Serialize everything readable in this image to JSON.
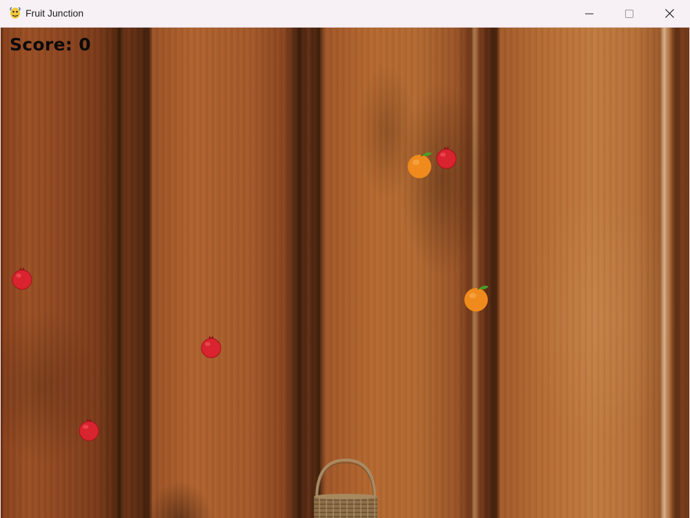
{
  "window": {
    "title": "Fruit Junction",
    "app_icon": "python-icon",
    "controls": [
      "minimize-icon",
      "maximize-icon",
      "close-icon"
    ]
  },
  "game": {
    "score_label": "Score: 0",
    "background": "wood-planks",
    "fruits": [
      {
        "type": "pomegranate",
        "color": "#d9232e"
      },
      {
        "type": "orange",
        "color": "#f08a1c"
      },
      {
        "type": "pomegranate",
        "color": "#d9232e"
      },
      {
        "type": "orange",
        "color": "#f08a1c"
      },
      {
        "type": "pomegranate",
        "color": "#d9232e"
      },
      {
        "type": "pomegranate",
        "color": "#d9232e"
      }
    ],
    "basket": "basket-icon"
  }
}
